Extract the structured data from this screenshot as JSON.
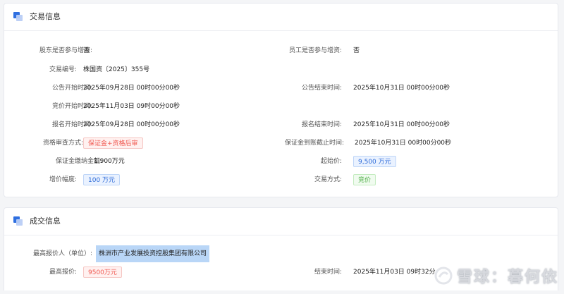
{
  "transaction_info": {
    "title": "交易信息",
    "shareholder_participate": {
      "label": "股东是否参与增资:",
      "value": "否"
    },
    "employee_participate": {
      "label": "员工是否参与增资:",
      "value": "否"
    },
    "transaction_no": {
      "label": "交易编号:",
      "value": "株国资〔2025〕355号"
    },
    "announce_start": {
      "label": "公告开始时间:",
      "value": "2025年09月28日 00时00分00秒"
    },
    "announce_end": {
      "label": "公告结束时间:",
      "value": "2025年10月31日 00时00分00秒"
    },
    "bid_start": {
      "label": "竞价开始时间:",
      "value": "2025年11月03日 09时00分00秒"
    },
    "signup_start": {
      "label": "报名开始时间:",
      "value": "2025年09月28日 00时00分00秒"
    },
    "signup_end": {
      "label": "报名结束时间:",
      "value": "2025年10月31日 00时00分00秒"
    },
    "qualification_review": {
      "label": "资格审查方式:",
      "value": "保证金+资格后审"
    },
    "deposit_deadline": {
      "label": "保证金到账截止时间:",
      "value": "2025年10月31日 00时00分00秒"
    },
    "deposit_amount": {
      "label": "保证金缴纳金额:",
      "value": "1,900万元"
    },
    "starting_price": {
      "label": "起始价:",
      "value": "9,500 万元"
    },
    "increment": {
      "label": "增价幅度:",
      "value": "100 万元"
    },
    "trade_method": {
      "label": "交易方式:",
      "value": "竞价"
    }
  },
  "deal_info": {
    "title": "成交信息",
    "top_bidder": {
      "label": "最高报价人（单位）:",
      "value": "株洲市产业发展投资控股集团有限公司"
    },
    "top_price": {
      "label": "最高报价:",
      "value": "9500万元"
    },
    "end_time": {
      "label": "结束时间:",
      "value": "2025年11月03日 09时32分"
    }
  },
  "watermark": {
    "text": "雪球：暮何依",
    "icon": "xueqiu-logo-icon"
  },
  "colors": {
    "accent": "#2f6fe0",
    "tag_red": "#f05a52",
    "tag_blue": "#2d6bd8",
    "tag_green": "#52b04a"
  }
}
